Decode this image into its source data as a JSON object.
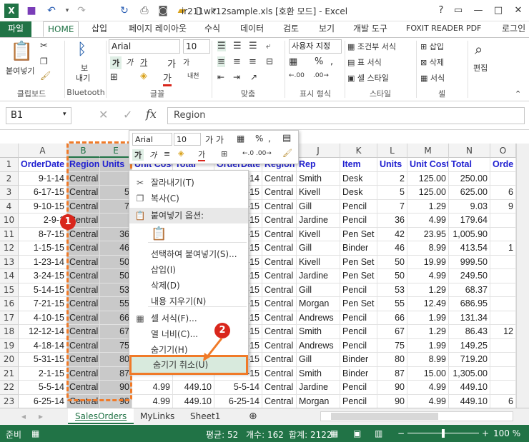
{
  "window": {
    "title": "ir211wk12sample.xls  [호환 모드] - Excel",
    "controls": [
      "?",
      "▭",
      "—",
      "□",
      "✕"
    ]
  },
  "quick_access": [
    "excel-logo-icon",
    "save-icon",
    "undo-icon",
    "undo-dropdown-icon",
    "redo-icon",
    "refresh-icon",
    "print-preview-icon",
    "camera-icon",
    "folder-icon",
    "new-file-icon",
    "more-icon"
  ],
  "tabs": [
    "파일",
    "HOME",
    "삽입",
    "페이지 레이아웃",
    "수식",
    "데이터",
    "검토",
    "보기",
    "개발 도구",
    "FOXIT READER PDF",
    "로그인"
  ],
  "ribbon": {
    "clipboard": {
      "paste": "붙여넣기",
      "label": "클립보드"
    },
    "bluetooth": {
      "send_line1": "보",
      "send_line2": "내기",
      "label": "Bluetooth"
    },
    "font": {
      "name": "Arial",
      "size": "10",
      "label": "글꼴",
      "bold": "가",
      "italic": "가",
      "underline": "가",
      "grow": "가",
      "shrink": "가",
      "phonetic": "내천"
    },
    "align": {
      "label": "맞춤"
    },
    "number": {
      "format": "사용자 지정",
      "label": "표시 형식"
    },
    "styles": {
      "cond": "조건부 서식",
      "table": "표 서식",
      "cell": "셀 스타일",
      "label": "스타일"
    },
    "cells": {
      "insert": "삽입",
      "delete": "삭제",
      "format": "서식",
      "label": "셀"
    },
    "editing": {
      "label": "편집"
    }
  },
  "formula": {
    "namebox": "B1",
    "value": "Region",
    "fx": "fx"
  },
  "columns": [
    "A",
    "B",
    "E",
    "",
    "",
    "",
    "",
    "",
    "J",
    "K",
    "L",
    "M",
    "N",
    "O"
  ],
  "rows": [
    "1",
    "2",
    "3",
    "4",
    "10",
    "11",
    "12",
    "13",
    "14",
    "15",
    "16",
    "17",
    "18",
    "19",
    "20",
    "21",
    "22",
    "23"
  ],
  "row1": {
    "A": "OrderDate",
    "B": "Region",
    "E": "Units",
    "F": "Unit Cost",
    "G": "Total",
    "H": "OrderDate",
    "I": "Region",
    "J": "Rep",
    "K": "Item",
    "L": "Units",
    "M": "Unit Cost",
    "N": "Total",
    "O": "Orde"
  },
  "colA": [
    "9-1-14",
    "6-17-15",
    "9-10-15",
    "2-9-1",
    "8-7-15",
    "1-15-15",
    "1-23-14",
    "3-24-15",
    "5-14-15",
    "7-21-15",
    "4-10-15",
    "12-12-14",
    "4-18-14",
    "5-31-15",
    "2-1-15",
    "5-5-14",
    "6-25-14"
  ],
  "colB": [
    "Central",
    "Central",
    "Central",
    "Central",
    "Central",
    "Central",
    "Central",
    "Central",
    "Central",
    "Central",
    "Central",
    "Central",
    "Central",
    "Central",
    "Central",
    "Central",
    "Central"
  ],
  "colE": [
    "",
    "5",
    "7",
    "",
    "36",
    "46",
    "50",
    "50",
    "53",
    "55",
    "66",
    "67",
    "75",
    "80",
    "87",
    "90",
    "90"
  ],
  "colH": [
    "-14",
    "-15",
    "-15",
    "-15",
    "-15",
    "-15",
    "-15",
    "-15",
    "-15",
    "-15",
    "-15",
    "-15",
    "-15",
    "-15",
    "-15",
    "5-5-14",
    "6-25-14"
  ],
  "colI": [
    "Central",
    "Central",
    "Central",
    "Central",
    "Central",
    "Central",
    "Central",
    "Central",
    "Central",
    "Central",
    "Central",
    "Central",
    "Central",
    "Central",
    "Central",
    "Central",
    "Central"
  ],
  "colJ": [
    "Smith",
    "Kivell",
    "Gill",
    "Jardine",
    "Kivell",
    "Gill",
    "Kivell",
    "Jardine",
    "Gill",
    "Morgan",
    "Andrews",
    "Smith",
    "Andrews",
    "Gill",
    "Smith",
    "Jardine",
    "Morgan"
  ],
  "colK": [
    "Desk",
    "Desk",
    "Pencil",
    "Pencil",
    "Pen Set",
    "Binder",
    "Pen Set",
    "Pen Set",
    "Pencil",
    "Pen Set",
    "Pencil",
    "Pencil",
    "Pencil",
    "Binder",
    "Binder",
    "Pencil",
    "Pencil"
  ],
  "colL": [
    "2",
    "5",
    "7",
    "36",
    "42",
    "46",
    "50",
    "50",
    "53",
    "55",
    "66",
    "67",
    "75",
    "80",
    "87",
    "90",
    "90"
  ],
  "colM": [
    "125.00",
    "125.00",
    "1.29",
    "4.99",
    "23.95",
    "8.99",
    "19.99",
    "4.99",
    "1.29",
    "12.49",
    "1.99",
    "1.29",
    "1.99",
    "8.99",
    "15.00",
    "4.99",
    "4.99"
  ],
  "colN": [
    "250.00",
    "625.00",
    "9.03",
    "179.64",
    "1,005.90",
    "413.54",
    "999.50",
    "249.50",
    "68.37",
    "686.95",
    "131.34",
    "86.43",
    "149.25",
    "719.20",
    "1,305.00",
    "449.10",
    "449.10"
  ],
  "colO": [
    "",
    "6",
    "9",
    "",
    "",
    "1",
    "",
    "",
    "",
    "",
    "",
    "12",
    "",
    "",
    "",
    "",
    "6"
  ],
  "partial": {
    "r2F": "125.00",
    "r2G": "250.00",
    "r22F": "4.99",
    "r22G": "449.10",
    "r23F": "4.99",
    "r23G": "449.10",
    "r23B": "Central"
  },
  "context_menu": [
    {
      "icon": "scissors-icon",
      "label": "잘라내기(T)"
    },
    {
      "icon": "copy-icon",
      "label": "복사(C)"
    },
    {
      "icon": "paste-icon",
      "label": "붙여넣기 옵션:"
    },
    {
      "icon": "",
      "label": ""
    },
    {
      "icon": "",
      "label": "선택하여 붙여넣기(S)..."
    },
    {
      "icon": "",
      "label": "삽입(I)"
    },
    {
      "icon": "",
      "label": "삭제(D)"
    },
    {
      "icon": "",
      "label": "내용 지우기(N)"
    },
    {
      "icon": "format-cells-icon",
      "label": "셀 서식(F)..."
    },
    {
      "icon": "",
      "label": "열 너비(C)..."
    },
    {
      "icon": "",
      "label": "숨기기(H)"
    },
    {
      "icon": "",
      "label": "숨기기 취소(U)"
    }
  ],
  "mini_toolbar": {
    "font": "Arial",
    "size": "10"
  },
  "callouts": [
    "1",
    "2"
  ],
  "sheets": [
    "SalesOrders",
    "MyLinks",
    "Sheet1"
  ],
  "status": {
    "ready": "준비",
    "average": "평균: 52",
    "count": "개수: 162",
    "sum": "합계: 2122",
    "zoom": "100 %"
  },
  "colors": {
    "accent": "#217346",
    "header_text": "#1f1fd0",
    "callout": "#d9261c",
    "dashed": "#f07a28"
  }
}
